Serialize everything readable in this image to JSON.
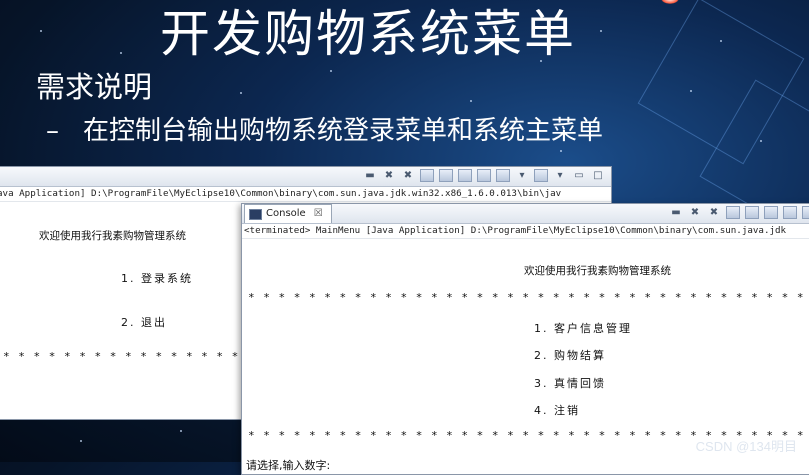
{
  "slide": {
    "title": "开发购物系统菜单",
    "heading": "需求说明",
    "bullet_dash": "–",
    "bullet_text": "在控制台输出购物系统登录菜单和系统主菜单"
  },
  "back_window": {
    "path": "ava Application] D:\\ProgramFile\\MyEclipse10\\Common\\binary\\com.sun.java.jdk.win32.x86_1.6.0.013\\bin\\jav",
    "welcome": "欢迎使用我行我素购物管理系统",
    "menu": [
      "1. 登录系统",
      "2. 退出"
    ],
    "stars": "* * * * * * * * * * * * * * * * *"
  },
  "front_window": {
    "tab_label": "Console",
    "tab_close": "☒",
    "path": "<terminated> MainMenu [Java Application] D:\\ProgramFile\\MyEclipse10\\Common\\binary\\com.sun.java.jdk",
    "welcome": "欢迎使用我行我素购物管理系统",
    "stars": "* * * * * * * * * * * * * * * * * * * * * * * * * * * * * * * * * * * * * *",
    "menu": [
      "1. 客户信息管理",
      "2. 购物结算",
      "3. 真情回馈",
      "4. 注销"
    ],
    "prompt": "请选择,输入数字:"
  },
  "watermark": "CSDN @134明目"
}
